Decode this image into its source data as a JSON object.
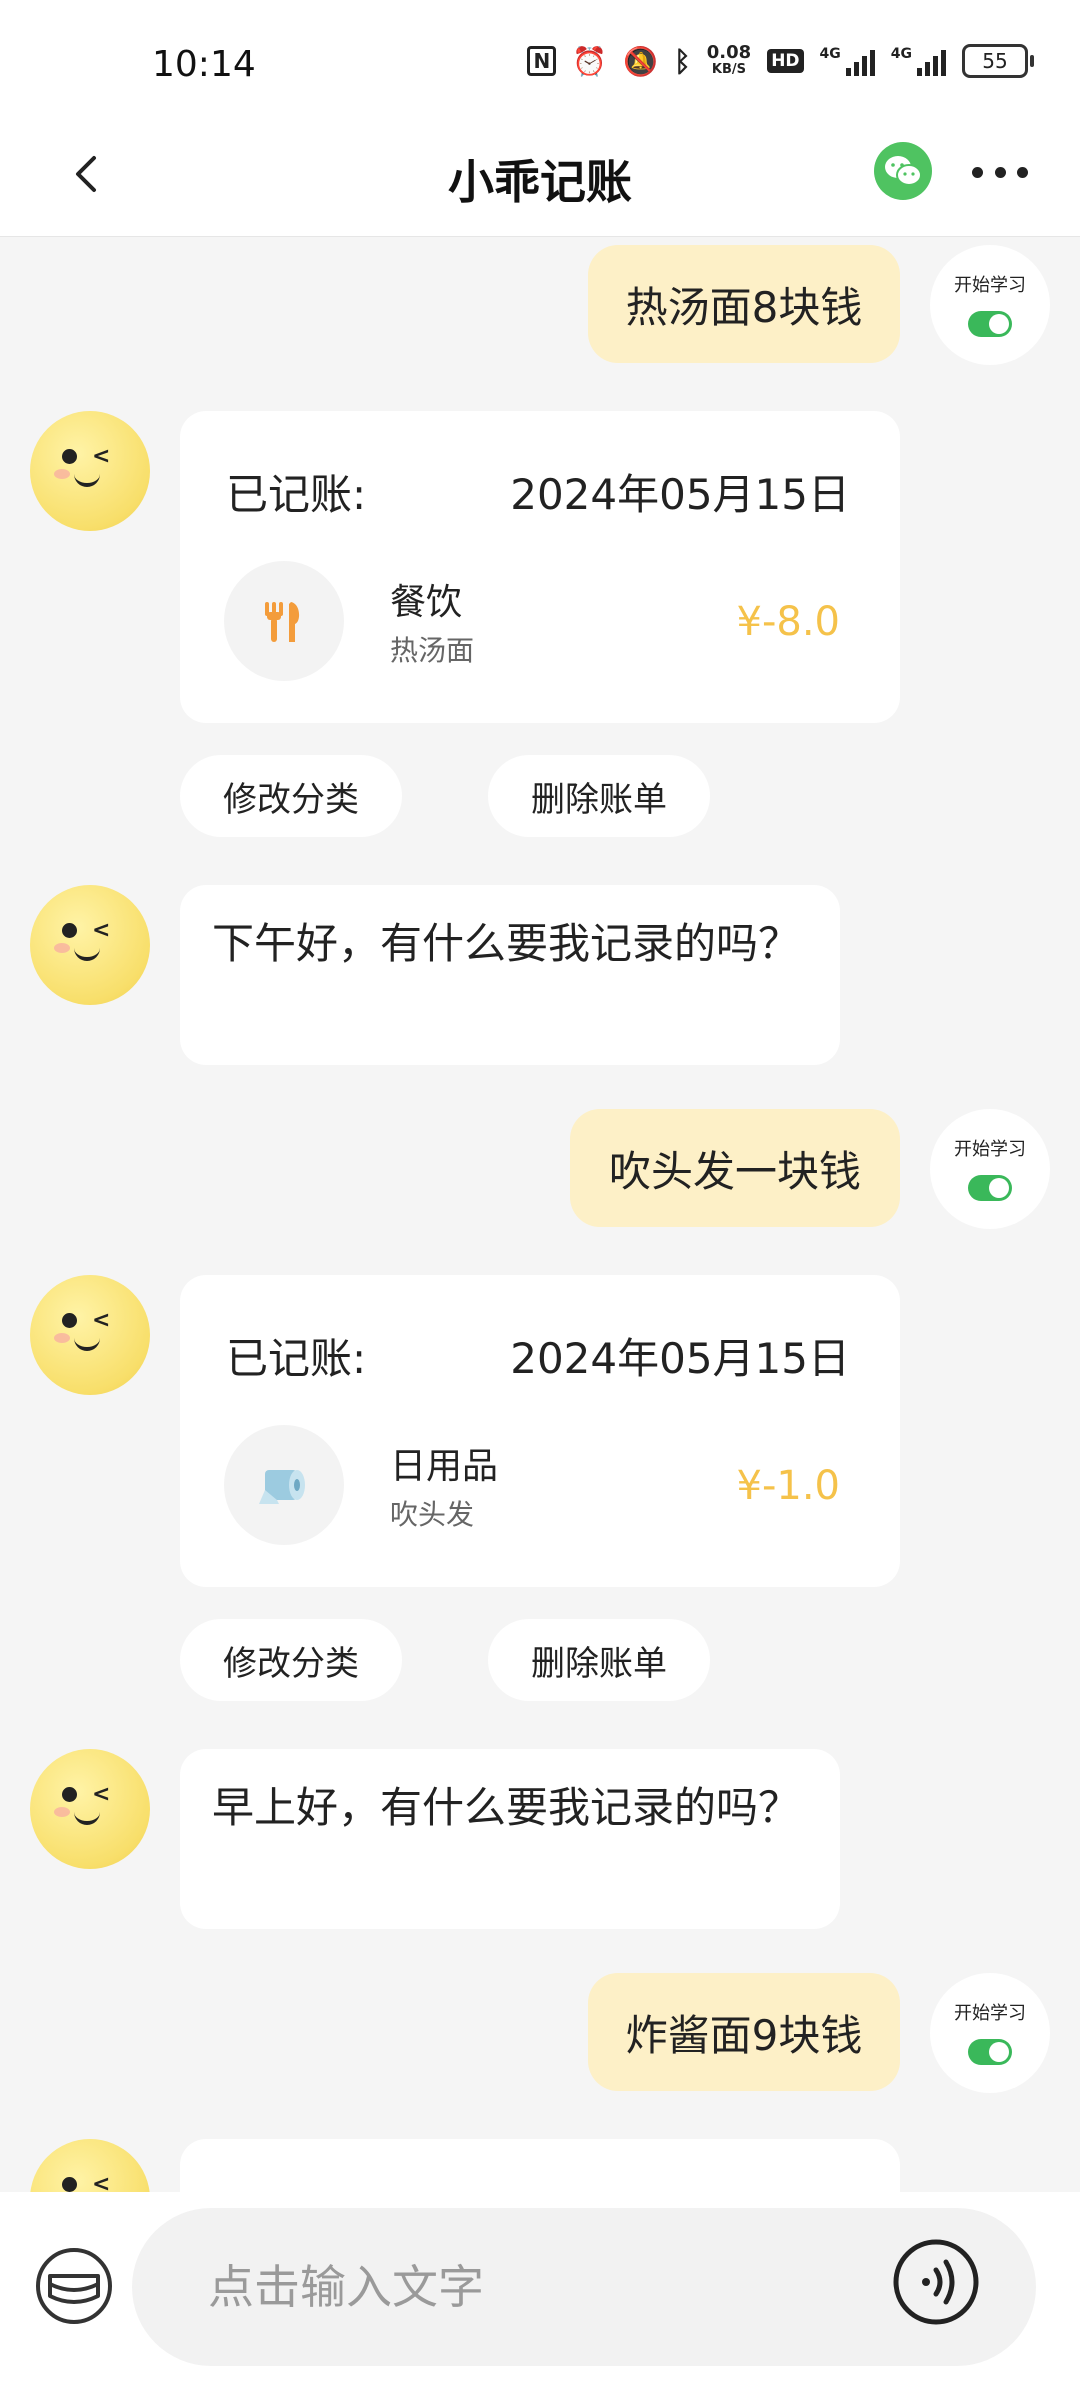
{
  "status_bar": {
    "time": "10:14",
    "net_speed_value": "0.08",
    "net_speed_unit": "KB/S",
    "hd": "HD",
    "sig1": "4G",
    "sig2": "4G",
    "battery": "55"
  },
  "header": {
    "title": "小乖记账"
  },
  "messages": {
    "m1": {
      "text": "热汤面8块钱",
      "learn_label": "开始学习"
    },
    "r1": {
      "prefix": "已记账:",
      "date": "2024年05月15日",
      "category": "餐饮",
      "note": "热汤面",
      "amount": "¥-8.0",
      "edit": "修改分类",
      "delete": "删除账单"
    },
    "g1": {
      "text": "下午好，有什么要我记录的吗？"
    },
    "m2": {
      "text": "吹头发一块钱",
      "learn_label": "开始学习"
    },
    "r2": {
      "prefix": "已记账:",
      "date": "2024年05月15日",
      "category": "日用品",
      "note": "吹头发",
      "amount": "¥-1.0",
      "edit": "修改分类",
      "delete": "删除账单"
    },
    "g2": {
      "text": "早上好，有什么要我记录的吗？"
    },
    "m3": {
      "text": "炸酱面9块钱",
      "learn_label": "开始学习"
    }
  },
  "input": {
    "placeholder": "点击输入文字"
  },
  "colors": {
    "accent_yellow": "#f5c24a",
    "bubble_user": "#fdf0c7",
    "toggle_on": "#3ab85a",
    "wechat": "#4fc361"
  },
  "icons": {
    "back": "chevron-left-icon",
    "wechat": "wechat-icon",
    "more": "more-dots-icon",
    "fork": "fork-knife-icon",
    "tissue": "tissue-roll-icon",
    "bill": "bill-icon",
    "voice": "voice-icon"
  }
}
